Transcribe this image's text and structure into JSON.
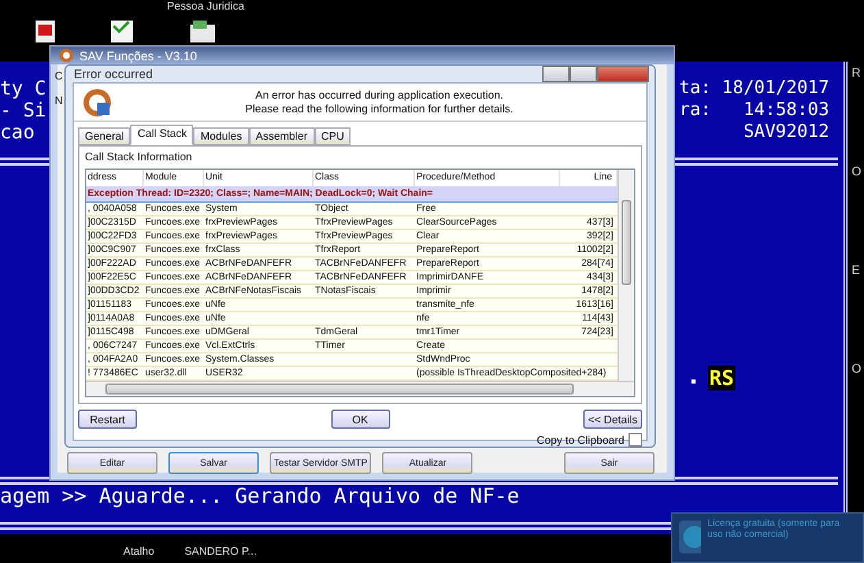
{
  "desktop": {
    "caption": "Pessoa Juridica",
    "taskbar_items": [
      "Atalho",
      "SANDERO P..."
    ]
  },
  "console": {
    "left_lines": [
      "ty C",
      "- Si",
      "cao"
    ],
    "right_lines": [
      "ta: 18/01/2017",
      "ra:   14:58:03",
      "SAV92012"
    ],
    "badge": "RS",
    "status": "agem >> Aguarde... Gerando Arquivo de NF-e",
    "edge_labels": [
      "R",
      "O",
      "E",
      "O"
    ]
  },
  "main_window": {
    "title": "SAV Funções - V3.10",
    "fragments": [
      "C",
      "N"
    ],
    "buttons": [
      {
        "label": "Editar",
        "selected": false
      },
      {
        "label": "Salvar",
        "selected": true
      },
      {
        "label": "Testar Servidor SMTP",
        "selected": false
      },
      {
        "label": "Atualizar",
        "selected": false
      },
      {
        "label": "Sair",
        "selected": false
      }
    ]
  },
  "error_dialog": {
    "title": "Error occurred",
    "message": [
      "An error has occurred during application execution.",
      "Please read the following information for further details."
    ],
    "tabs": [
      {
        "label": "General",
        "selected": false
      },
      {
        "label": "Call Stack",
        "selected": true
      },
      {
        "label": "Modules",
        "selected": false
      },
      {
        "label": "Assembler",
        "selected": false
      },
      {
        "label": "CPU",
        "selected": false
      }
    ],
    "section_title": "Call Stack Information",
    "table": {
      "columns": [
        "ddress",
        "Module",
        "Unit",
        "Class",
        "Procedure/Method",
        "Line"
      ],
      "exception_row": "Exception Thread: ID=2320; Class=; Name=MAIN; DeadLock=0; Wait Chain=",
      "rows": [
        [
          ", 0040A058",
          "Funcoes.exe",
          "System",
          "TObject",
          "Free",
          ""
        ],
        [
          "]00C2315D",
          "Funcoes.exe",
          "frxPreviewPages",
          "TfrxPreviewPages",
          "ClearSourcePages",
          "437[3]"
        ],
        [
          "]00C22FD3",
          "Funcoes.exe",
          "frxPreviewPages",
          "TfrxPreviewPages",
          "Clear",
          "392[2]"
        ],
        [
          "]00C9C907",
          "Funcoes.exe",
          "frxClass",
          "TfrxReport",
          "PrepareReport",
          "11002[2]"
        ],
        [
          "]00F222AD",
          "Funcoes.exe",
          "ACBrNFeDANFEFR",
          "TACBrNFeDANFEFR",
          "PrepareReport",
          "284[74]"
        ],
        [
          "]00F22E5C",
          "Funcoes.exe",
          "ACBrNFeDANFEFR",
          "TACBrNFeDANFEFR",
          "ImprimirDANFE",
          "434[3]"
        ],
        [
          "]00DD3CD2",
          "Funcoes.exe",
          "ACBrNFeNotasFiscais",
          "TNotasFiscais",
          "Imprimir",
          "1478[2]"
        ],
        [
          "]01151183",
          "Funcoes.exe",
          "uNfe",
          "",
          "transmite_nfe",
          "1613[16]"
        ],
        [
          "]0114A0A8",
          "Funcoes.exe",
          "uNfe",
          "",
          "nfe",
          "114[43]"
        ],
        [
          "]0115C498",
          "Funcoes.exe",
          "uDMGeral",
          "TdmGeral",
          "tmr1Timer",
          "724[23]"
        ],
        [
          ", 006C7247",
          "Funcoes.exe",
          "Vcl.ExtCtrls",
          "TTimer",
          "Create",
          ""
        ],
        [
          ", 004FA2A0",
          "Funcoes.exe",
          "System.Classes",
          "",
          "StdWndProc",
          ""
        ],
        [
          "! 773486EC",
          "user32.dll",
          "USER32",
          "",
          "(possible IsThreadDesktopComposited+284)",
          ""
        ]
      ]
    },
    "buttons": [
      "Restart",
      "OK",
      "<< Details"
    ],
    "copy_to_clipboard": {
      "label": "Copy to Clipboard",
      "checked": false
    }
  },
  "notification": {
    "text": "Licença gratuita (somente para uso não comercial)"
  }
}
